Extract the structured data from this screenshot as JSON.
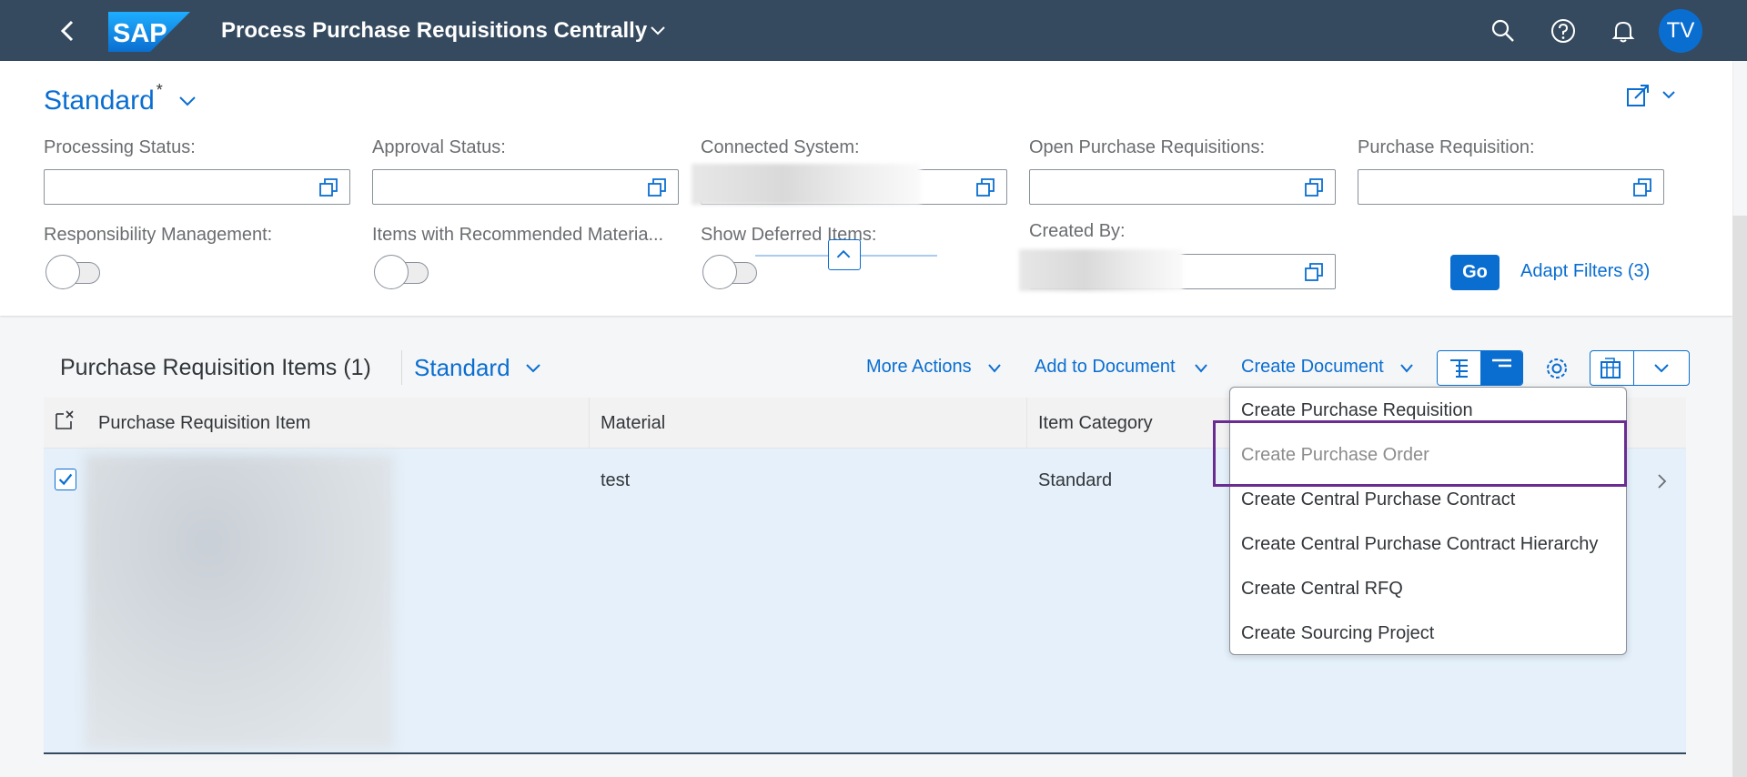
{
  "shell": {
    "app_title": "Process Purchase Requisitions Centrally",
    "avatar_initials": "TV"
  },
  "filterbar": {
    "variant_name": "Standard",
    "variant_modified_marker": "*",
    "fields": {
      "processing_status": "Processing Status:",
      "approval_status": "Approval Status:",
      "connected_system": "Connected System:",
      "open_pr": "Open Purchase Requisitions:",
      "purchase_requisition": "Purchase Requisition:",
      "responsibility_mgmt": "Responsibility Management:",
      "items_recommended": "Items with Recommended Materia...",
      "show_deferred": "Show Deferred Items:",
      "created_by": "Created By:"
    },
    "go_label": "Go",
    "adapt_filters_label": "Adapt Filters (3)"
  },
  "table": {
    "title": "Purchase Requisition Items (1)",
    "variant": "Standard",
    "toolbar": {
      "more_actions": "More Actions",
      "add_to_document": "Add to Document",
      "create_document": "Create Document"
    },
    "columns": [
      "Purchase Requisition Item",
      "Material",
      "Item Category"
    ],
    "rows": [
      {
        "material": "test",
        "item_category": "Standard",
        "selected": true
      }
    ]
  },
  "menu": {
    "items": [
      "Create Purchase Requisition",
      "Create Purchase Order",
      "Create Central Purchase Contract",
      "Create Central Purchase Contract Hierarchy",
      "Create Central RFQ",
      "Create Sourcing Project"
    ],
    "disabled_item": "Create Purchase Order"
  },
  "colors": {
    "shell_bg": "#354a5f",
    "accent": "#0a6ed1",
    "highlight_border": "#6a2c91",
    "row_selected_bg": "#e5f0fa"
  },
  "icons": [
    "back-icon",
    "sap-logo",
    "chevron-down-icon",
    "search-icon",
    "help-icon",
    "bell-icon",
    "share-icon",
    "value-help-icon",
    "collapse-up-icon",
    "tree-table-icon",
    "flat-table-icon",
    "gear-icon",
    "export-icon",
    "select-all-icon",
    "checkbox-icon",
    "navigation-arrow-icon"
  ]
}
